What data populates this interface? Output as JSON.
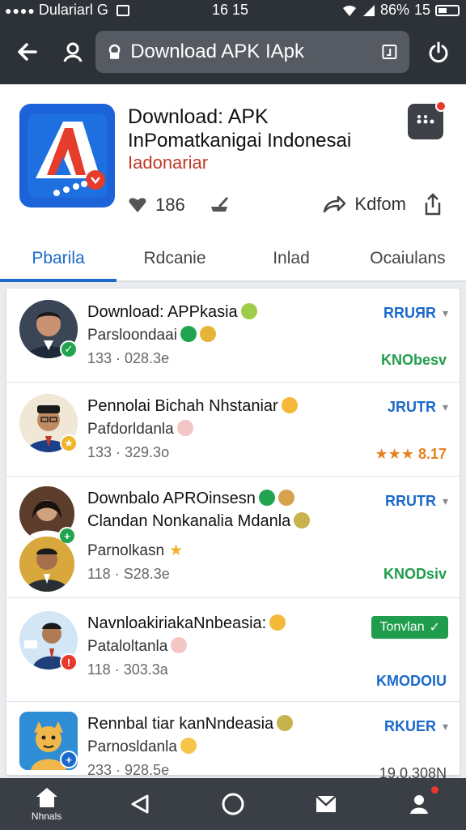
{
  "status": {
    "carrier": "Dulariarl G",
    "time": "16 15",
    "battery_pct": "86%",
    "clock_right": "15"
  },
  "search": {
    "value": "Download APK IApk"
  },
  "app": {
    "title": "Download: APK",
    "subtitle": "InPomatkanigai Indonesai",
    "developer": "Iadonariar",
    "rating_count": "186",
    "share_label": "Kdfom"
  },
  "tabs": [
    {
      "label": "Pbarila",
      "active": true
    },
    {
      "label": "Rdcanie",
      "active": false
    },
    {
      "label": "Inlad",
      "active": false
    },
    {
      "label": "Ocaiulans",
      "active": false
    }
  ],
  "rows": [
    {
      "title": "Download: APPkasia",
      "subtitle": "Parsloondaai",
      "meta": "133 · 028.3e",
      "action": "RRUЯR",
      "right": "KNObesv"
    },
    {
      "title": "Pennolai Bichah Nhstaniar",
      "subtitle": "Pafdorldanla",
      "meta": "133 · 329.3o",
      "action": "JRUTR",
      "right": "★★★ 8.17"
    },
    {
      "title": "Downbalo APROinsesn",
      "title2": "Clandan Nonkanalia Mdanla",
      "subtitle": "Parnolkasn",
      "meta": "118 · S28.3e",
      "action": "RRUTR",
      "right": "KNODsiv"
    },
    {
      "title": "NavnloakiriakaNnbeasia:",
      "subtitle": "Pataloltanla",
      "meta": "118 · 303.3a",
      "action": "Tonvlan",
      "right": "KMODOIU"
    },
    {
      "title": "Rennbal tiar kanNndeasia",
      "subtitle": "Parnosldanla",
      "meta": "233 · 928.5e",
      "action": "RKUER",
      "right": "19.0.308N"
    }
  ],
  "nav": [
    {
      "label": "Nhnals",
      "icon": "home-icon"
    },
    {
      "label": "",
      "icon": "back-triangle-icon"
    },
    {
      "label": "",
      "icon": "circle-home-icon"
    },
    {
      "label": "",
      "icon": "mail-icon"
    },
    {
      "label": "",
      "icon": "profile-icon"
    }
  ],
  "colors": {
    "accent": "#1b69c9",
    "toolbar": "#2d3138",
    "green": "#1f9d4c",
    "red": "#e8392c"
  }
}
